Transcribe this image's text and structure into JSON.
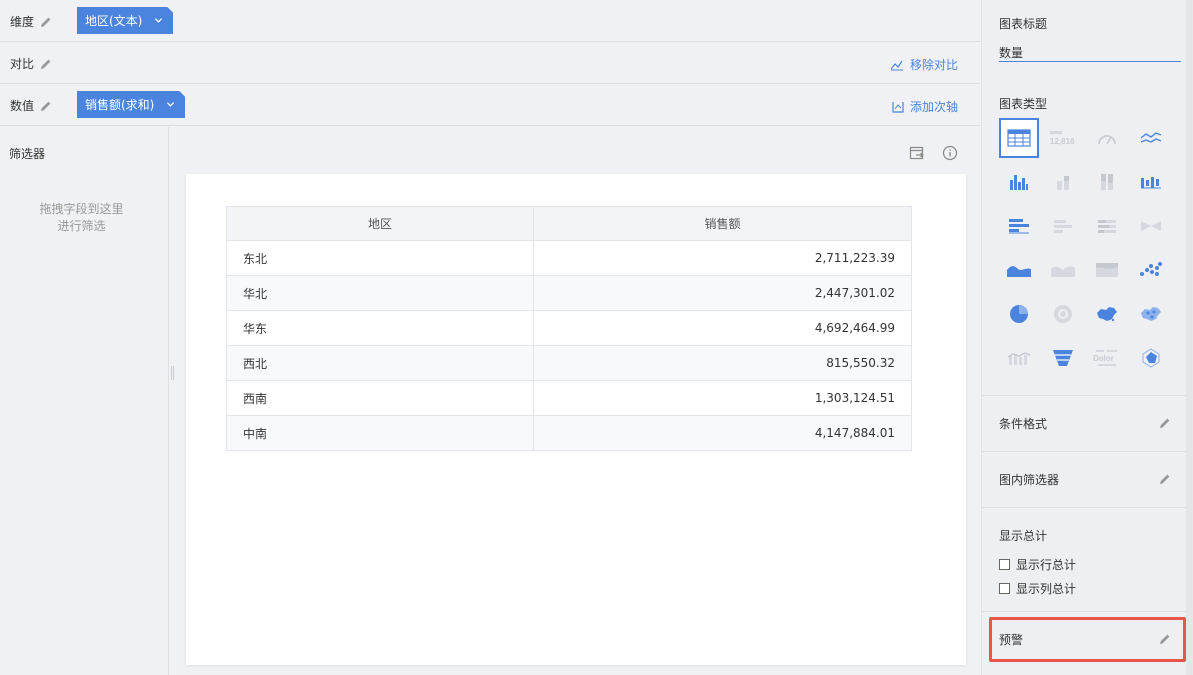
{
  "shelves": {
    "dimension": {
      "label": "维度",
      "chip": "地区(文本)"
    },
    "compare": {
      "label": "对比",
      "action": "移除对比"
    },
    "values": {
      "label": "数值",
      "chip": "销售额(求和)",
      "action": "添加次轴"
    }
  },
  "filter": {
    "title": "筛选器",
    "hint_line1": "拖拽字段到这里",
    "hint_line2": "进行筛选"
  },
  "table": {
    "headers": [
      "地区",
      "销售额"
    ],
    "rows": [
      [
        "东北",
        "2,711,223.39"
      ],
      [
        "华北",
        "2,447,301.02"
      ],
      [
        "华东",
        "4,692,464.99"
      ],
      [
        "西北",
        "815,550.32"
      ],
      [
        "西南",
        "1,303,124.51"
      ],
      [
        "中南",
        "4,147,884.01"
      ]
    ]
  },
  "panel": {
    "chart_title_label": "图表标题",
    "chart_title_value": "数量",
    "chart_type_label": "图表类型",
    "chart_type_icons": [
      "table-icon",
      "kpi-number-icon",
      "gauge-icon",
      "line-chart-icon",
      "column-chart-icon",
      "stacked-column-icon",
      "percent-column-icon",
      "column-compare-icon",
      "bar-chart-icon",
      "stacked-bar-icon",
      "percent-bar-icon",
      "bar-compare-icon",
      "area-chart-icon",
      "stacked-area-icon",
      "percent-area-icon",
      "scatter-chart-icon",
      "pie-chart-icon",
      "ring-chart-icon",
      "region-map-icon",
      "point-map-icon",
      "combo-chart-icon",
      "funnel-chart-icon",
      "word-cloud-icon",
      "radar-chart-icon"
    ],
    "kpi_icon_text": "12,816",
    "wordcloud_icon_text": "Dolor",
    "conditional_format": "条件格式",
    "inner_filter": "图内筛选器",
    "show_total": "显示总计",
    "row_total": "显示行总计",
    "col_total": "显示列总计",
    "alarm": "预警"
  },
  "colors": {
    "accent": "#4a84de",
    "highlight": "#e8554a"
  }
}
